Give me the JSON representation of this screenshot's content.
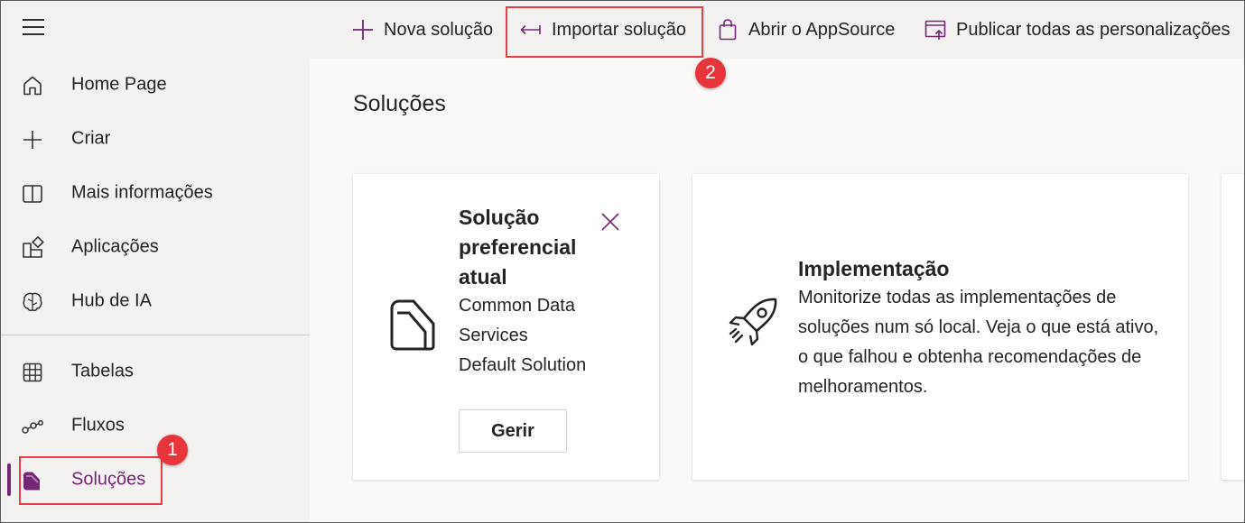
{
  "sidebar": {
    "menu_icon": "hamburger-icon",
    "items": [
      {
        "label": "Home Page",
        "icon": "home-icon"
      },
      {
        "label": "Criar",
        "icon": "plus-icon"
      },
      {
        "label": "Mais informações",
        "icon": "book-icon"
      },
      {
        "label": "Aplicações",
        "icon": "apps-icon"
      },
      {
        "label": "Hub de IA",
        "icon": "brain-icon"
      },
      {
        "label": "Tabelas",
        "icon": "table-icon"
      },
      {
        "label": "Fluxos",
        "icon": "flow-icon"
      },
      {
        "label": "Soluções",
        "icon": "solutions-icon",
        "active": true
      }
    ],
    "accent_color": "#742774"
  },
  "toolbar": {
    "new_solution": "Nova solução",
    "import_solution": "Importar solução",
    "open_appsource": "Abrir o AppSource",
    "publish_all": "Publicar todas as personalizações"
  },
  "main": {
    "title": "Soluções",
    "preferred_card": {
      "title": "Solução preferencial atual",
      "solution_name": "Common Data Services Default Solution",
      "manage_label": "Gerir"
    },
    "deployment_card": {
      "title": "Implementação",
      "description": "Monitorize todas as implementações de soluções num só local. Veja o que está ativo, o que falhou e obtenha recomendações de melhoramentos."
    }
  },
  "annotations": {
    "step1": "1",
    "step2": "2",
    "color": "#e8353b"
  }
}
